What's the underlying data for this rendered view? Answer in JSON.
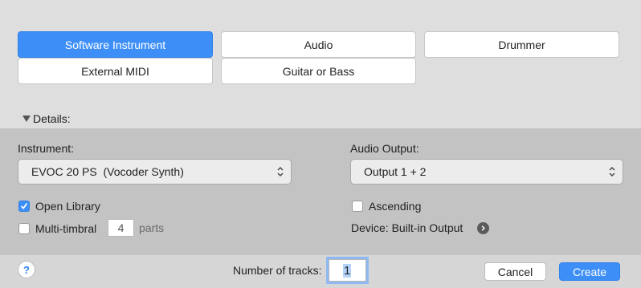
{
  "track_types": {
    "software_instrument": "Software Instrument",
    "audio": "Audio",
    "drummer": "Drummer",
    "external_midi": "External MIDI",
    "guitar_or_bass": "Guitar or Bass",
    "selected": "Software Instrument"
  },
  "details": {
    "toggle_label": "Details:",
    "instrument_label": "Instrument:",
    "instrument_value": "EVOC 20 PS  (Vocoder Synth)",
    "audio_output_label": "Audio Output:",
    "audio_output_value": "Output 1 + 2",
    "open_library_label": "Open Library",
    "open_library_checked": true,
    "ascending_label": "Ascending",
    "ascending_checked": false,
    "multitimbral_label": "Multi-timbral",
    "multitimbral_checked": false,
    "parts_value": "4",
    "parts_label": "parts",
    "device_label": "Device: Built-in Output"
  },
  "footer": {
    "help_label": "?",
    "tracks_label": "Number of tracks:",
    "tracks_value": "1",
    "cancel_label": "Cancel",
    "create_label": "Create"
  },
  "colors": {
    "accent": "#3d8ff7"
  },
  "icons": {
    "disclosure": "disclosure-triangle-down-icon",
    "popup": "up-down-chevron-icon",
    "device": "chevron-right-circle-icon",
    "check": "checkmark-icon"
  }
}
